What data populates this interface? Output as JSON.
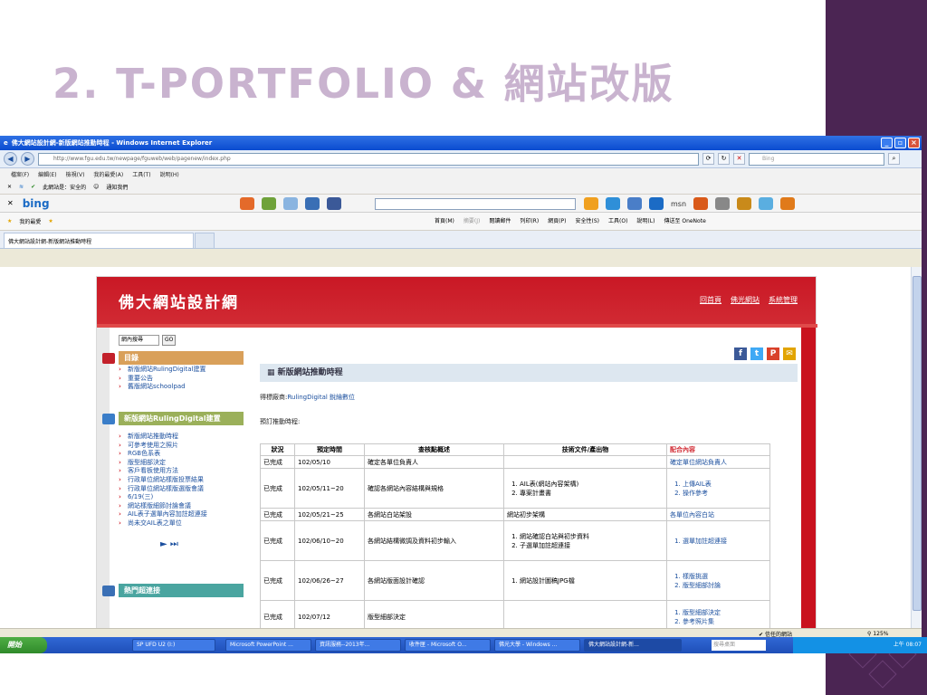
{
  "slide_title": "2. T-PORTFOLIO & 網站改版",
  "browser": {
    "window_title": "佛大網站設計網-新版網站推動時程 - Windows Internet Explorer",
    "address": "http://www.fgu.edu.tw/newpage/fguweb/web/pagenew/index.php",
    "search_placeholder": "Bing",
    "menu": [
      "檔案(F)",
      "編輯(E)",
      "檢視(V)",
      "我的最愛(A)",
      "工具(T)",
      "說明(H)"
    ],
    "security_text": "此網站是：安全的",
    "notify_text": "通知我們",
    "bing_logo": "bing",
    "favorites_label": "我的最愛",
    "commands": [
      "首頁(M)",
      "摘要(J)",
      "閱讀郵件",
      "列印(R)",
      "網頁(P)",
      "安全性(S)",
      "工具(O)",
      "說明(L)",
      "傳送至 OneNote"
    ],
    "tab_label": "佛大網站設計網-新版網站推動時程",
    "status_trust": "信任的網站",
    "status_zoom": "125%"
  },
  "site": {
    "logo": "佛大網站設計網",
    "top_links": [
      "回首頁",
      "佛光網站",
      "系統管理"
    ],
    "search_label": "網內搜尋",
    "go_label": "GO",
    "menu_head": "目錄",
    "menu_items": [
      "新版網站RulingDigital建置",
      "重要公告",
      "舊版網站schoolpad"
    ],
    "build_head": "新版網站RulingDigital建置",
    "build_items": [
      "新版網站推動時程",
      "可參考使用之照片",
      "RGB色系表",
      "版型細部決定",
      "客戶看板使用方法",
      "行政單位網站樣版投票結果",
      "行政單位網站樣版選版會議",
      "6/19(三)",
      "網站樣版細節討論會議",
      "AIL表子選單內容加註超連接",
      "尚未交AIL表之單位"
    ],
    "play_controls": "► ⏭",
    "links_head": "熱門超連接",
    "section_title": "新版網站推動時程",
    "contractor_label": "得標廠商:",
    "contractor_value": "RulingDigital 銳綸數位",
    "schedule_label": "預訂推動時程:",
    "table": {
      "headers": [
        "狀況",
        "預定時間",
        "查核點概述",
        "技術文件/產出物",
        "配合內容"
      ],
      "rows": [
        {
          "status": "已完成",
          "date": "102/05/10",
          "desc": "確定各單位負責人",
          "docs": [],
          "docs_text": "",
          "coop": [],
          "coop_text": "確定單位網站負責人"
        },
        {
          "status": "已完成",
          "date": "102/05/11~20",
          "desc": "確認各網站內容結構與規格",
          "docs": [
            "AIL表(網站內容架構)",
            "專案計畫書"
          ],
          "docs_text": "",
          "coop": [
            "上傳AIL表",
            "操作參考"
          ],
          "coop_text": ""
        },
        {
          "status": "已完成",
          "date": "102/05/21~25",
          "desc": "各網站白站架設",
          "docs": [],
          "docs_text": "網站初步架構",
          "coop": [],
          "coop_text": "各單位內容白站"
        },
        {
          "status": "已完成",
          "date": "102/06/10~20",
          "desc": "各網站結構微調及資料初步輸入",
          "docs": [
            "網站確認白站與初步資料",
            "子選單加註超連接"
          ],
          "docs_text": "",
          "coop": [
            "選單加註超連接"
          ],
          "coop_text": ""
        },
        {
          "status": "已完成",
          "date": "102/06/26~27",
          "desc": "各網站版面設計確認",
          "docs": [
            "網站設計圖稿JPG檔"
          ],
          "docs_text": "",
          "coop": [
            "樣版挑選",
            "版型細部討論"
          ],
          "coop_text": ""
        },
        {
          "status": "已完成",
          "date": "102/07/12",
          "desc": "版型細部決定",
          "docs": [],
          "docs_text": "",
          "coop": [
            "版型細部決定",
            "參考照片集"
          ],
          "coop_text": ""
        }
      ]
    }
  },
  "taskbar": {
    "start": "開始",
    "items": [
      "SP UFD U2 (I:)",
      "Microsoft PowerPoint ...",
      "資訊服務--2013年...",
      "收件匣 - Microsoft O...",
      "佛光大學 - Windows ...",
      "佛大網站設計網-新..."
    ],
    "search_placeholder": "搜尋桌面",
    "clock": "上午 08:07"
  },
  "colors": {
    "purple_band": "#4b2553",
    "site_red": "#c91825",
    "link_blue": "#1b4f9e"
  }
}
